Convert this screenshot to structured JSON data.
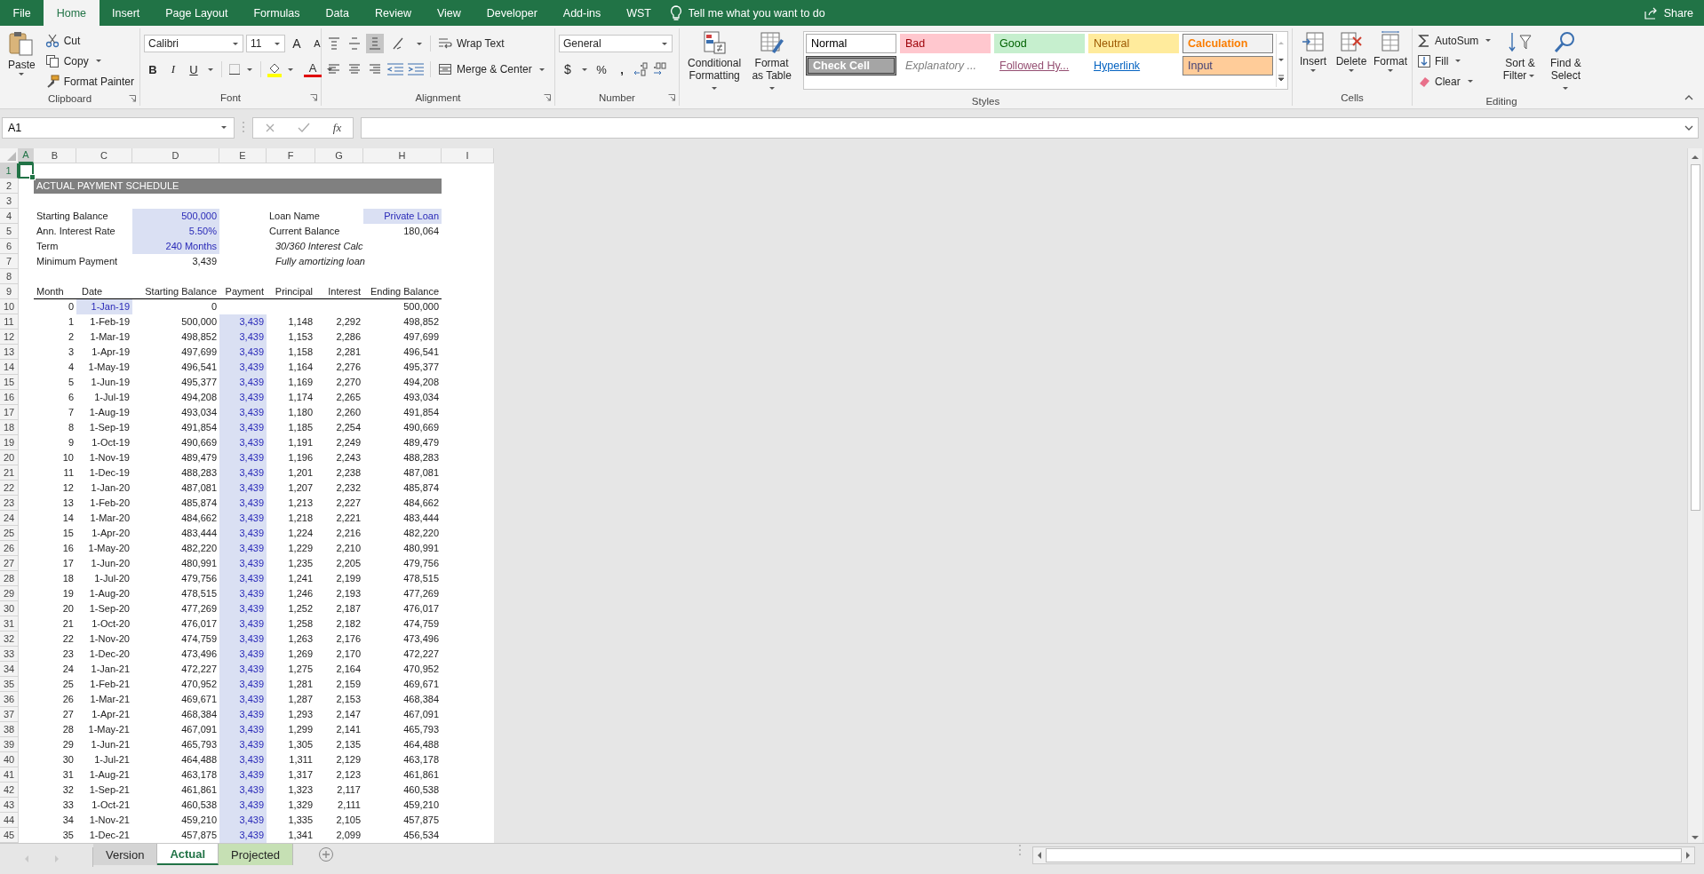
{
  "ribbon_tabs": [
    {
      "label": "File",
      "selected": false
    },
    {
      "label": "Home",
      "selected": true
    },
    {
      "label": "Insert",
      "selected": false
    },
    {
      "label": "Page Layout",
      "selected": false
    },
    {
      "label": "Formulas",
      "selected": false
    },
    {
      "label": "Data",
      "selected": false
    },
    {
      "label": "Review",
      "selected": false
    },
    {
      "label": "View",
      "selected": false
    },
    {
      "label": "Developer",
      "selected": false
    },
    {
      "label": "Add-ins",
      "selected": false
    },
    {
      "label": "WST",
      "selected": false
    }
  ],
  "tell_me": {
    "placeholder": "Tell me what you want to do"
  },
  "share": "Share",
  "ribbon": {
    "clipboard": {
      "label": "Clipboard",
      "paste": "Paste",
      "cut": "Cut",
      "copy": "Copy",
      "format_painter": "Format Painter"
    },
    "font": {
      "label": "Font",
      "family": "Calibri",
      "size": "11",
      "grow": "A",
      "shrink": "A",
      "bold": "B",
      "italic": "I",
      "underline": "U",
      "font_color": "A"
    },
    "alignment": {
      "label": "Alignment",
      "wrap_text": "Wrap Text",
      "merge_center": "Merge & Center",
      "vertical": [
        {
          "kind": "top",
          "selected": false
        },
        {
          "kind": "middle",
          "selected": false
        },
        {
          "kind": "bottom",
          "selected": true
        }
      ],
      "horizontal": [
        {
          "kind": "left",
          "selected": false
        },
        {
          "kind": "center",
          "selected": false
        },
        {
          "kind": "right",
          "selected": false
        }
      ]
    },
    "number": {
      "label": "Number",
      "format": "General",
      "currency": "$",
      "percent": "%",
      "comma": ","
    },
    "styles": {
      "label": "Styles",
      "conditional_formatting": "Conditional Formatting",
      "format_as_table": "Format as Table",
      "gallery": [
        {
          "label": "Normal",
          "kind": "normal"
        },
        {
          "label": "Bad",
          "kind": "bad"
        },
        {
          "label": "Good",
          "kind": "good"
        },
        {
          "label": "Neutral",
          "kind": "neutral"
        },
        {
          "label": "Calculation",
          "kind": "calculation"
        },
        {
          "label": "Check Cell",
          "kind": "check"
        },
        {
          "label": "Explanatory ...",
          "kind": "explanatory"
        },
        {
          "label": "Followed Hy...",
          "kind": "followed"
        },
        {
          "label": "Hyperlink",
          "kind": "hyperlink"
        },
        {
          "label": "Input",
          "kind": "input"
        }
      ]
    },
    "cells": {
      "label": "Cells",
      "insert": "Insert",
      "delete": "Delete",
      "format": "Format"
    },
    "editing": {
      "label": "Editing",
      "autosum": "AutoSum",
      "fill": "Fill",
      "clear": "Clear",
      "sort_filter": "Sort & Filter",
      "find_select": "Find & Select"
    }
  },
  "formula_bar": {
    "name_box": "A1",
    "function_glyph": "fx"
  },
  "sheet": {
    "columns": [
      {
        "label": "A",
        "selected": true
      },
      {
        "label": "B",
        "selected": false
      },
      {
        "label": "C",
        "selected": false
      },
      {
        "label": "D",
        "selected": false
      },
      {
        "label": "E",
        "selected": false
      },
      {
        "label": "F",
        "selected": false
      },
      {
        "label": "G",
        "selected": false
      },
      {
        "label": "H",
        "selected": false
      },
      {
        "label": "I",
        "selected": false
      }
    ],
    "rows": [
      {
        "label": "1",
        "selected": true
      },
      {
        "label": "2",
        "selected": false
      },
      {
        "label": "3",
        "selected": false
      },
      {
        "label": "4",
        "selected": false
      },
      {
        "label": "5",
        "selected": false
      },
      {
        "label": "6",
        "selected": false
      },
      {
        "label": "7",
        "selected": false
      },
      {
        "label": "8",
        "selected": false
      },
      {
        "label": "9",
        "selected": false
      },
      {
        "label": "10",
        "selected": false
      },
      {
        "label": "11",
        "selected": false
      },
      {
        "label": "12",
        "selected": false
      },
      {
        "label": "13",
        "selected": false
      },
      {
        "label": "14",
        "selected": false
      },
      {
        "label": "15",
        "selected": false
      },
      {
        "label": "16",
        "selected": false
      },
      {
        "label": "17",
        "selected": false
      },
      {
        "label": "18",
        "selected": false
      },
      {
        "label": "19",
        "selected": false
      },
      {
        "label": "20",
        "selected": false
      },
      {
        "label": "21",
        "selected": false
      },
      {
        "label": "22",
        "selected": false
      },
      {
        "label": "23",
        "selected": false
      },
      {
        "label": "24",
        "selected": false
      },
      {
        "label": "25",
        "selected": false
      },
      {
        "label": "26",
        "selected": false
      },
      {
        "label": "27",
        "selected": false
      },
      {
        "label": "28",
        "selected": false
      },
      {
        "label": "29",
        "selected": false
      },
      {
        "label": "30",
        "selected": false
      },
      {
        "label": "31",
        "selected": false
      },
      {
        "label": "32",
        "selected": false
      },
      {
        "label": "33",
        "selected": false
      },
      {
        "label": "34",
        "selected": false
      },
      {
        "label": "35",
        "selected": false
      },
      {
        "label": "36",
        "selected": false
      },
      {
        "label": "37",
        "selected": false
      },
      {
        "label": "38",
        "selected": false
      },
      {
        "label": "39",
        "selected": false
      },
      {
        "label": "40",
        "selected": false
      },
      {
        "label": "41",
        "selected": false
      },
      {
        "label": "42",
        "selected": false
      },
      {
        "label": "43",
        "selected": false
      },
      {
        "label": "44",
        "selected": false
      },
      {
        "label": "45",
        "selected": false
      }
    ],
    "title": "ACTUAL PAYMENT SCHEDULE",
    "parameters": [
      {
        "label": "Starting Balance",
        "value": "500,000",
        "highlighted": true
      },
      {
        "label": "Ann. Interest Rate",
        "value": "5.50%",
        "highlighted": true
      },
      {
        "label": "Term",
        "value": "240 Months",
        "highlighted": true
      },
      {
        "label": "Minimum Payment",
        "value": "3,439",
        "highlighted": false
      }
    ],
    "loan_info": [
      {
        "label": "Loan Name",
        "value": "Private Loan",
        "highlighted": true
      },
      {
        "label": "Current Balance",
        "value": "180,064",
        "highlighted": false
      }
    ],
    "notes": [
      "30/360 Interest Calc",
      "Fully amortizing loan"
    ],
    "headers": [
      "Month",
      "Date",
      "Starting Balance",
      "Payment",
      "Principal",
      "Interest",
      "Ending Balance"
    ],
    "schedule": [
      {
        "month": "0",
        "date": "1-Jan-19",
        "start": "0",
        "end": "500,000",
        "date_highlighted": true,
        "payment_highlighted": false
      },
      {
        "month": "1",
        "date": "1-Feb-19",
        "start": "500,000",
        "payment": "3,439",
        "principal": "1,148",
        "interest": "2,292",
        "end": "498,852",
        "date_highlighted": false,
        "payment_highlighted": true
      },
      {
        "month": "2",
        "date": "1-Mar-19",
        "start": "498,852",
        "payment": "3,439",
        "principal": "1,153",
        "interest": "2,286",
        "end": "497,699",
        "date_highlighted": false,
        "payment_highlighted": true
      },
      {
        "month": "3",
        "date": "1-Apr-19",
        "start": "497,699",
        "payment": "3,439",
        "principal": "1,158",
        "interest": "2,281",
        "end": "496,541",
        "date_highlighted": false,
        "payment_highlighted": true
      },
      {
        "month": "4",
        "date": "1-May-19",
        "start": "496,541",
        "payment": "3,439",
        "principal": "1,164",
        "interest": "2,276",
        "end": "495,377",
        "date_highlighted": false,
        "payment_highlighted": true
      },
      {
        "month": "5",
        "date": "1-Jun-19",
        "start": "495,377",
        "payment": "3,439",
        "principal": "1,169",
        "interest": "2,270",
        "end": "494,208",
        "date_highlighted": false,
        "payment_highlighted": true
      },
      {
        "month": "6",
        "date": "1-Jul-19",
        "start": "494,208",
        "payment": "3,439",
        "principal": "1,174",
        "interest": "2,265",
        "end": "493,034",
        "date_highlighted": false,
        "payment_highlighted": true
      },
      {
        "month": "7",
        "date": "1-Aug-19",
        "start": "493,034",
        "payment": "3,439",
        "principal": "1,180",
        "interest": "2,260",
        "end": "491,854",
        "date_highlighted": false,
        "payment_highlighted": true
      },
      {
        "month": "8",
        "date": "1-Sep-19",
        "start": "491,854",
        "payment": "3,439",
        "principal": "1,185",
        "interest": "2,254",
        "end": "490,669",
        "date_highlighted": false,
        "payment_highlighted": true
      },
      {
        "month": "9",
        "date": "1-Oct-19",
        "start": "490,669",
        "payment": "3,439",
        "principal": "1,191",
        "interest": "2,249",
        "end": "489,479",
        "date_highlighted": false,
        "payment_highlighted": true
      },
      {
        "month": "10",
        "date": "1-Nov-19",
        "start": "489,479",
        "payment": "3,439",
        "principal": "1,196",
        "interest": "2,243",
        "end": "488,283",
        "date_highlighted": false,
        "payment_highlighted": true
      },
      {
        "month": "11",
        "date": "1-Dec-19",
        "start": "488,283",
        "payment": "3,439",
        "principal": "1,201",
        "interest": "2,238",
        "end": "487,081",
        "date_highlighted": false,
        "payment_highlighted": true
      },
      {
        "month": "12",
        "date": "1-Jan-20",
        "start": "487,081",
        "payment": "3,439",
        "principal": "1,207",
        "interest": "2,232",
        "end": "485,874",
        "date_highlighted": false,
        "payment_highlighted": true
      },
      {
        "month": "13",
        "date": "1-Feb-20",
        "start": "485,874",
        "payment": "3,439",
        "principal": "1,213",
        "interest": "2,227",
        "end": "484,662",
        "date_highlighted": false,
        "payment_highlighted": true
      },
      {
        "month": "14",
        "date": "1-Mar-20",
        "start": "484,662",
        "payment": "3,439",
        "principal": "1,218",
        "interest": "2,221",
        "end": "483,444",
        "date_highlighted": false,
        "payment_highlighted": true
      },
      {
        "month": "15",
        "date": "1-Apr-20",
        "start": "483,444",
        "payment": "3,439",
        "principal": "1,224",
        "interest": "2,216",
        "end": "482,220",
        "date_highlighted": false,
        "payment_highlighted": true
      },
      {
        "month": "16",
        "date": "1-May-20",
        "start": "482,220",
        "payment": "3,439",
        "principal": "1,229",
        "interest": "2,210",
        "end": "480,991",
        "date_highlighted": false,
        "payment_highlighted": true
      },
      {
        "month": "17",
        "date": "1-Jun-20",
        "start": "480,991",
        "payment": "3,439",
        "principal": "1,235",
        "interest": "2,205",
        "end": "479,756",
        "date_highlighted": false,
        "payment_highlighted": true
      },
      {
        "month": "18",
        "date": "1-Jul-20",
        "start": "479,756",
        "payment": "3,439",
        "principal": "1,241",
        "interest": "2,199",
        "end": "478,515",
        "date_highlighted": false,
        "payment_highlighted": true
      },
      {
        "month": "19",
        "date": "1-Aug-20",
        "start": "478,515",
        "payment": "3,439",
        "principal": "1,246",
        "interest": "2,193",
        "end": "477,269",
        "date_highlighted": false,
        "payment_highlighted": true
      },
      {
        "month": "20",
        "date": "1-Sep-20",
        "start": "477,269",
        "payment": "3,439",
        "principal": "1,252",
        "interest": "2,187",
        "end": "476,017",
        "date_highlighted": false,
        "payment_highlighted": true
      },
      {
        "month": "21",
        "date": "1-Oct-20",
        "start": "476,017",
        "payment": "3,439",
        "principal": "1,258",
        "interest": "2,182",
        "end": "474,759",
        "date_highlighted": false,
        "payment_highlighted": true
      },
      {
        "month": "22",
        "date": "1-Nov-20",
        "start": "474,759",
        "payment": "3,439",
        "principal": "1,263",
        "interest": "2,176",
        "end": "473,496",
        "date_highlighted": false,
        "payment_highlighted": true
      },
      {
        "month": "23",
        "date": "1-Dec-20",
        "start": "473,496",
        "payment": "3,439",
        "principal": "1,269",
        "interest": "2,170",
        "end": "472,227",
        "date_highlighted": false,
        "payment_highlighted": true
      },
      {
        "month": "24",
        "date": "1-Jan-21",
        "start": "472,227",
        "payment": "3,439",
        "principal": "1,275",
        "interest": "2,164",
        "end": "470,952",
        "date_highlighted": false,
        "payment_highlighted": true
      },
      {
        "month": "25",
        "date": "1-Feb-21",
        "start": "470,952",
        "payment": "3,439",
        "principal": "1,281",
        "interest": "2,159",
        "end": "469,671",
        "date_highlighted": false,
        "payment_highlighted": true
      },
      {
        "month": "26",
        "date": "1-Mar-21",
        "start": "469,671",
        "payment": "3,439",
        "principal": "1,287",
        "interest": "2,153",
        "end": "468,384",
        "date_highlighted": false,
        "payment_highlighted": true
      },
      {
        "month": "27",
        "date": "1-Apr-21",
        "start": "468,384",
        "payment": "3,439",
        "principal": "1,293",
        "interest": "2,147",
        "end": "467,091",
        "date_highlighted": false,
        "payment_highlighted": true
      },
      {
        "month": "28",
        "date": "1-May-21",
        "start": "467,091",
        "payment": "3,439",
        "principal": "1,299",
        "interest": "2,141",
        "end": "465,793",
        "date_highlighted": false,
        "payment_highlighted": true
      },
      {
        "month": "29",
        "date": "1-Jun-21",
        "start": "465,793",
        "payment": "3,439",
        "principal": "1,305",
        "interest": "2,135",
        "end": "464,488",
        "date_highlighted": false,
        "payment_highlighted": true
      },
      {
        "month": "30",
        "date": "1-Jul-21",
        "start": "464,488",
        "payment": "3,439",
        "principal": "1,311",
        "interest": "2,129",
        "end": "463,178",
        "date_highlighted": false,
        "payment_highlighted": true
      },
      {
        "month": "31",
        "date": "1-Aug-21",
        "start": "463,178",
        "payment": "3,439",
        "principal": "1,317",
        "interest": "2,123",
        "end": "461,861",
        "date_highlighted": false,
        "payment_highlighted": true
      },
      {
        "month": "32",
        "date": "1-Sep-21",
        "start": "461,861",
        "payment": "3,439",
        "principal": "1,323",
        "interest": "2,117",
        "end": "460,538",
        "date_highlighted": false,
        "payment_highlighted": true
      },
      {
        "month": "33",
        "date": "1-Oct-21",
        "start": "460,538",
        "payment": "3,439",
        "principal": "1,329",
        "interest": "2,111",
        "end": "459,210",
        "date_highlighted": false,
        "payment_highlighted": true
      },
      {
        "month": "34",
        "date": "1-Nov-21",
        "start": "459,210",
        "payment": "3,439",
        "principal": "1,335",
        "interest": "2,105",
        "end": "457,875",
        "date_highlighted": false,
        "payment_highlighted": true
      },
      {
        "month": "35",
        "date": "1-Dec-21",
        "start": "457,875",
        "payment": "3,439",
        "principal": "1,341",
        "interest": "2,099",
        "end": "456,534",
        "date_highlighted": false,
        "payment_highlighted": true
      }
    ]
  },
  "sheet_tabs": [
    {
      "label": "Version",
      "selected": false,
      "color": "#d4d4d4"
    },
    {
      "label": "Actual",
      "selected": true
    },
    {
      "label": "Projected",
      "selected": false,
      "color": "#c6e0b4"
    }
  ]
}
